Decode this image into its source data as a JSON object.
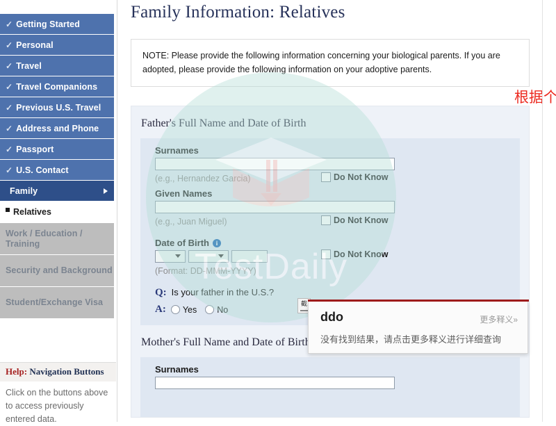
{
  "sidebar": {
    "nav_items": [
      {
        "label": "Getting Started",
        "check": "✓",
        "state": "completed"
      },
      {
        "label": "Personal",
        "check": "✓",
        "state": "completed"
      },
      {
        "label": "Travel",
        "check": "✓",
        "state": "completed"
      },
      {
        "label": "Travel Companions",
        "check": "✓",
        "state": "completed"
      },
      {
        "label": "Previous U.S. Travel",
        "check": "✓",
        "state": "completed"
      },
      {
        "label": "Address and Phone",
        "check": "✓",
        "state": "completed"
      },
      {
        "label": "Passport",
        "check": "✓",
        "state": "completed"
      },
      {
        "label": "U.S. Contact",
        "check": "✓",
        "state": "completed"
      },
      {
        "label": "Family",
        "check": "",
        "state": "active"
      }
    ],
    "sub_item": {
      "label": "Relatives"
    },
    "disabled_items": [
      {
        "label": "Work / Education / Training"
      },
      {
        "label": "Security and Background"
      },
      {
        "label": "Student/Exchange Visa"
      }
    ],
    "help": {
      "title_red": "Help:",
      "title_rest": " Navigation Buttons",
      "body": "Click on the buttons above to access previously entered data."
    }
  },
  "main": {
    "page_title": "Family Information: Relatives",
    "note": "NOTE: Please provide the following information concerning your biological parents. If you are adopted, please provide the following information on your adoptive parents.",
    "father": {
      "section_title": "Father's Full Name and Date of Birth",
      "surnames_label": "Surnames",
      "surnames_value": "",
      "surnames_hint": "(e.g., Hernandez Garcia)",
      "surnames_dnk": "Do Not Know",
      "given_label": "Given Names",
      "given_value": "",
      "given_hint": "(e.g., Juan Miguel)",
      "given_dnk": "Do Not Know",
      "dob_label": "Date of Birth",
      "dob_info_icon": "info-icon",
      "dob_day": "",
      "dob_month": "",
      "dob_year": "",
      "dob_dnk": "Do Not Know",
      "dob_format": "(Format: DD-MMM-YYYY)",
      "q_tag": "Q:",
      "q_text": "Is your father in the U.S.?",
      "a_tag": "A:",
      "radio_yes": "Yes",
      "radio_no": "No"
    },
    "mother": {
      "section_title": "Mother's Full Name and Date of Birth",
      "surnames_label": "Surnames",
      "surnames_value": ""
    }
  },
  "annotation": {
    "red_note": "根据个人情况如实填写"
  },
  "watermark": {
    "text": "TestDaily"
  },
  "dictionary_popup": {
    "word": "ddo",
    "more_link": "更多释义»",
    "message": "没有找到结果，请点击更多释义进行详细查询"
  },
  "snip_tool": {
    "label": "截"
  },
  "colors": {
    "nav_blue": "#4e72ad",
    "nav_active": "#2e4f89",
    "nav_disabled": "#bdbdbd",
    "title_navy": "#27325a",
    "panel_outer": "#eef2f8",
    "panel_inner": "#dfe7f2",
    "annotation_red": "#ec2a20",
    "popup_rule_red": "#9e1b1b",
    "watermark_teal": "#b3ddd6"
  }
}
